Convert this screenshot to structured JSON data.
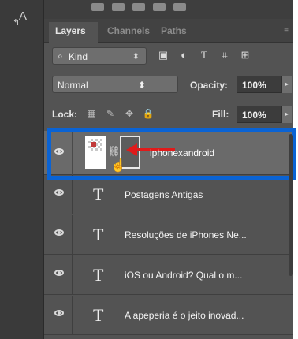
{
  "tool": {
    "glyph_big": "A",
    "glyph_small": "↰"
  },
  "tabs": {
    "layers": "Layers",
    "channels": "Channels",
    "paths": "Paths",
    "menu_icon": "hamburger-icon"
  },
  "filter": {
    "search_icon": "⌕",
    "kind_label": "Kind",
    "select_arrows": "⬍",
    "icons": [
      "image-filter-icon",
      "adjustment-filter-icon",
      "type-filter-icon",
      "shape-filter-icon",
      "smartobject-filter-icon"
    ],
    "icon_glyphs": [
      "▣",
      "◐",
      "T",
      "⌗",
      "⊞"
    ]
  },
  "blend": {
    "mode": "Normal",
    "arrows": "⬍",
    "opacity_label": "Opacity:",
    "opacity_value": "100%",
    "dropdown_arrow": "▸"
  },
  "lock": {
    "label": "Lock:",
    "icon_glyphs": [
      "▦",
      "✎",
      "✥",
      "🔒"
    ],
    "fill_label": "Fill:",
    "fill_value": "100%",
    "dropdown_arrow": "▸"
  },
  "layers": [
    {
      "name": "iphonexandroid",
      "type": "smart",
      "selected": true
    },
    {
      "name": "Postagens Antigas",
      "type": "text"
    },
    {
      "name": "Resoluções de iPhones Ne...",
      "type": "text"
    },
    {
      "name": "iOS ou Android? Qual o m...",
      "type": "text"
    },
    {
      "name": "A apeperia é o jeito inovad...",
      "type": "text"
    }
  ],
  "type_glyph": "T",
  "chain_glyph": "⛓",
  "cursor_glyph": "☝",
  "colors": {
    "panel": "#535353",
    "selected": "#6a6a6a",
    "highlight": "#0a63d4",
    "arrow": "#e01a1a"
  }
}
